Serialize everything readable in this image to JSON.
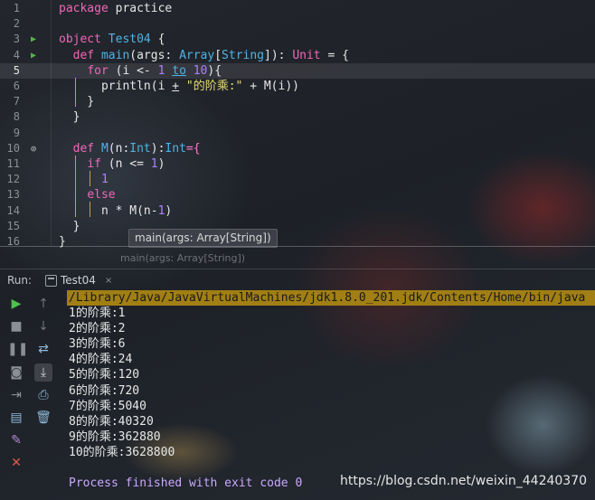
{
  "editor": {
    "lines": [
      {
        "num": "1",
        "segments": [
          {
            "t": "package ",
            "c": "kw"
          },
          {
            "t": "practice",
            "c": ""
          }
        ]
      },
      {
        "num": "2",
        "segments": []
      },
      {
        "num": "3",
        "mark": "run",
        "segments": [
          {
            "t": "object ",
            "c": "kw"
          },
          {
            "t": "Test04",
            "c": "ty"
          },
          {
            "t": " {",
            "c": ""
          }
        ]
      },
      {
        "num": "4",
        "mark": "run",
        "segments": [
          {
            "t": "  ",
            "c": ""
          },
          {
            "t": "def ",
            "c": "kw"
          },
          {
            "t": "main",
            "c": "ty"
          },
          {
            "t": "(args: ",
            "c": ""
          },
          {
            "t": "Array",
            "c": "ty"
          },
          {
            "t": "[",
            "c": ""
          },
          {
            "t": "String",
            "c": "ty"
          },
          {
            "t": "]): ",
            "c": ""
          },
          {
            "t": "Unit",
            "c": "kw"
          },
          {
            "t": " = {",
            "c": ""
          }
        ]
      },
      {
        "num": "5",
        "current": true,
        "segments": [
          {
            "t": "    ",
            "c": ""
          },
          {
            "t": "for",
            "c": "kw"
          },
          {
            "t": " (i <- ",
            "c": ""
          },
          {
            "t": "1",
            "c": "num"
          },
          {
            "t": " ",
            "c": ""
          },
          {
            "t": "to",
            "c": "ty ul"
          },
          {
            "t": " ",
            "c": ""
          },
          {
            "t": "10",
            "c": "num"
          },
          {
            "t": "){",
            "c": ""
          }
        ]
      },
      {
        "num": "6",
        "segments": [
          {
            "t": "      println(i ",
            "c": ""
          },
          {
            "t": "+",
            "c": "ul"
          },
          {
            "t": " ",
            "c": ""
          },
          {
            "t": "\"的阶乘:\"",
            "c": "str"
          },
          {
            "t": " + M(i))",
            "c": ""
          }
        ]
      },
      {
        "num": "7",
        "segments": [
          {
            "t": "    }",
            "c": ""
          }
        ]
      },
      {
        "num": "8",
        "segments": [
          {
            "t": "  }",
            "c": ""
          }
        ]
      },
      {
        "num": "9",
        "segments": []
      },
      {
        "num": "10",
        "mark": "override",
        "segments": [
          {
            "t": "  ",
            "c": ""
          },
          {
            "t": "def ",
            "c": "kw"
          },
          {
            "t": "M",
            "c": "ty"
          },
          {
            "t": "(n:",
            "c": ""
          },
          {
            "t": "Int",
            "c": "ty"
          },
          {
            "t": "):",
            "c": ""
          },
          {
            "t": "Int",
            "c": "ty"
          },
          {
            "t": "={",
            "c": "pr"
          }
        ]
      },
      {
        "num": "11",
        "segments": [
          {
            "t": "    ",
            "c": ""
          },
          {
            "t": "if",
            "c": "kw"
          },
          {
            "t": " (n <= ",
            "c": ""
          },
          {
            "t": "1",
            "c": "num"
          },
          {
            "t": ")",
            "c": ""
          }
        ]
      },
      {
        "num": "12",
        "segments": [
          {
            "t": "      ",
            "c": ""
          },
          {
            "t": "1",
            "c": "num"
          }
        ]
      },
      {
        "num": "13",
        "segments": [
          {
            "t": "    ",
            "c": ""
          },
          {
            "t": "else",
            "c": "kw"
          }
        ]
      },
      {
        "num": "14",
        "segments": [
          {
            "t": "      n * M(n-",
            "c": ""
          },
          {
            "t": "1",
            "c": "num"
          },
          {
            "t": ")",
            "c": ""
          }
        ]
      },
      {
        "num": "15",
        "segments": [
          {
            "t": "  }",
            "c": ""
          }
        ]
      },
      {
        "num": "16",
        "segments": [
          {
            "t": "}",
            "c": ""
          }
        ]
      }
    ],
    "tooltip": "main(args: Array[String])",
    "breadcrumb": "main(args: Array[String])"
  },
  "run_panel": {
    "label": "Run:",
    "tab_label": "Test04",
    "tab_close": "×",
    "toolbar_left": [
      {
        "name": "rerun-icon",
        "glyph": "▶",
        "color": "#4fbf4f"
      },
      {
        "name": "stop-icon",
        "glyph": "■",
        "color": "#8a8e95"
      },
      {
        "name": "pause-icon",
        "glyph": "❚❚",
        "color": "#8a8e95"
      },
      {
        "name": "dump-threads-icon",
        "glyph": "◙",
        "color": "#8a8e95"
      },
      {
        "name": "exit-icon",
        "glyph": "⇥",
        "color": "#8a8e95"
      },
      {
        "name": "layout-icon",
        "glyph": "▤",
        "color": "#8fb8d8"
      },
      {
        "name": "pin-icon",
        "glyph": "✎",
        "color": "#b08ad6"
      },
      {
        "name": "close-icon",
        "glyph": "✕",
        "color": "#e05a4f"
      }
    ],
    "toolbar_right": [
      {
        "name": "scroll-up-icon",
        "glyph": "↑",
        "color": "#6e7278"
      },
      {
        "name": "scroll-down-icon",
        "glyph": "↓",
        "color": "#6e7278"
      },
      {
        "name": "soft-wrap-icon",
        "glyph": "⇄",
        "color": "#8fb8d8"
      },
      {
        "name": "scroll-to-end-icon",
        "glyph": "⤓",
        "color": "#d0d3d8",
        "selected": true
      },
      {
        "name": "print-icon",
        "glyph": "⎙",
        "color": "#8fb8d8"
      },
      {
        "name": "trash-icon",
        "glyph": "🗑",
        "color": "#8fb8d8"
      }
    ],
    "console_lines": [
      {
        "text": "/Library/Java/JavaVirtualMachines/jdk1.8.0_201.jdk/Contents/Home/bin/java",
        "kind": "path"
      },
      {
        "text": "1的阶乘:1",
        "kind": ""
      },
      {
        "text": "2的阶乘:2",
        "kind": ""
      },
      {
        "text": "3的阶乘:6",
        "kind": ""
      },
      {
        "text": "4的阶乘:24",
        "kind": ""
      },
      {
        "text": "5的阶乘:120",
        "kind": ""
      },
      {
        "text": "6的阶乘:720",
        "kind": ""
      },
      {
        "text": "7的阶乘:5040",
        "kind": ""
      },
      {
        "text": "8的阶乘:40320",
        "kind": ""
      },
      {
        "text": "9的阶乘:362880",
        "kind": ""
      },
      {
        "text": "10的阶乘:3628800",
        "kind": ""
      },
      {
        "text": "",
        "kind": ""
      },
      {
        "text": "Process finished with exit code 0",
        "kind": "exit"
      }
    ]
  },
  "watermark": "https://blog.csdn.net/weixin_44240370"
}
